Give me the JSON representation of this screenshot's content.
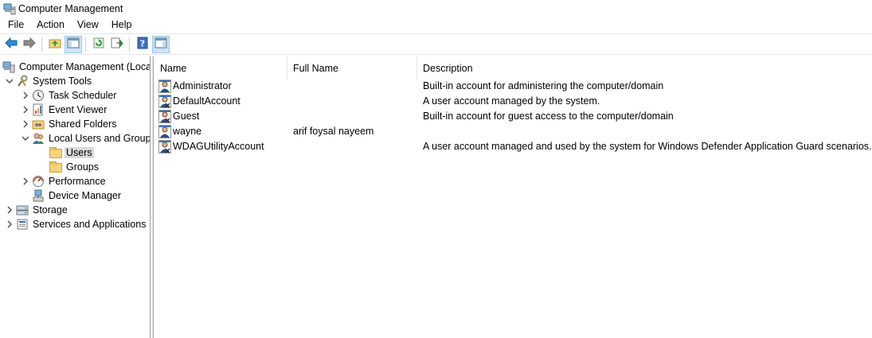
{
  "window": {
    "title": "Computer Management",
    "icon": "computer-management-icon"
  },
  "menu": [
    "File",
    "Action",
    "View",
    "Help"
  ],
  "toolbar": {
    "buttons": [
      "back-arrow-icon",
      "forward-arrow-icon",
      "up-folder-icon",
      "show-hide-console-tree-icon",
      "refresh-icon",
      "export-list-icon",
      "help-icon",
      "show-hide-action-pane-icon"
    ]
  },
  "tree": {
    "root": "Computer Management (Local",
    "system_tools": "System Tools",
    "task_scheduler": "Task Scheduler",
    "event_viewer": "Event Viewer",
    "shared_folders": "Shared Folders",
    "local_users_groups": "Local Users and Groups",
    "users": "Users",
    "groups": "Groups",
    "performance": "Performance",
    "device_manager": "Device Manager",
    "storage": "Storage",
    "services_apps": "Services and Applications"
  },
  "list": {
    "columns": {
      "name": "Name",
      "full_name": "Full Name",
      "description": "Description"
    },
    "rows": [
      {
        "name": "Administrator",
        "full_name": "",
        "description": "Built-in account for administering the computer/domain"
      },
      {
        "name": "DefaultAccount",
        "full_name": "",
        "description": "A user account managed by the system."
      },
      {
        "name": "Guest",
        "full_name": "",
        "description": "Built-in account for guest access to the computer/domain"
      },
      {
        "name": "wayne",
        "full_name": "arif foysal nayeem",
        "description": ""
      },
      {
        "name": "WDAGUtilityAccount",
        "full_name": "",
        "description": "A user account managed and used by the system for Windows Defender Application Guard scenarios."
      }
    ]
  },
  "colors": {
    "selection": "#d9d9d9",
    "pressed_button": "#cce4f7",
    "folder": "#f5d47a"
  }
}
